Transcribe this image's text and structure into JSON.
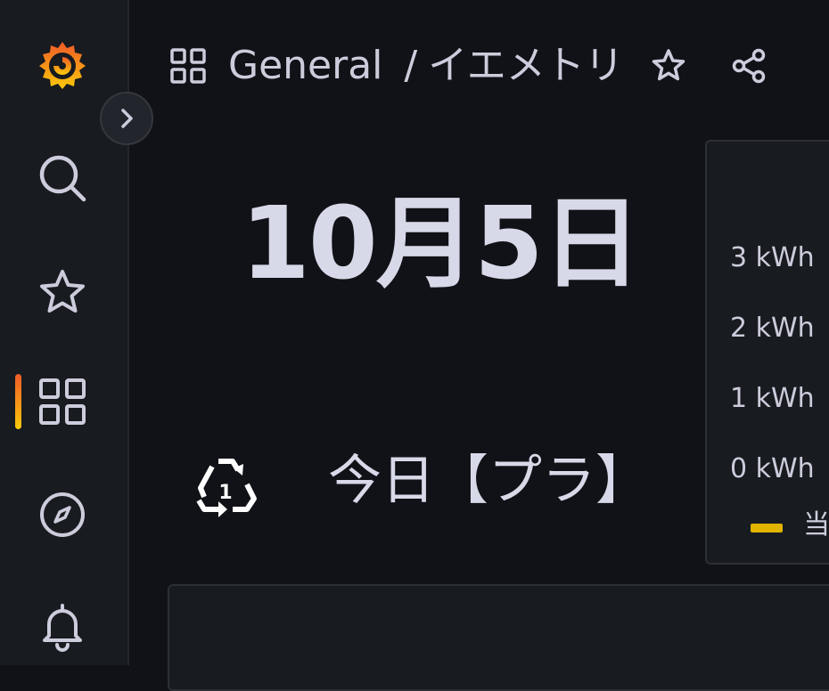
{
  "nav": {
    "items": [
      {
        "icon": "grafana-logo-icon"
      },
      {
        "icon": "search-icon"
      },
      {
        "icon": "star-icon"
      },
      {
        "icon": "dashboards-grid-icon",
        "active": true
      },
      {
        "icon": "explore-compass-icon"
      },
      {
        "icon": "alerting-bell-icon"
      }
    ],
    "expand_icon": "chevron-right-icon"
  },
  "breadcrumb": {
    "folder": "General",
    "separator": "/",
    "dashboard": "イエメトリ"
  },
  "header_actions": [
    "star-outline-icon",
    "share-icon"
  ],
  "panels": {
    "date": {
      "value": "10月5日"
    },
    "garbage": {
      "icon": "recycle-pet-1-icon",
      "label": "今日【プラ】"
    },
    "energy": {
      "y_ticks": [
        "3 kWh",
        "2 kWh",
        "1 kWh",
        "0 kWh"
      ],
      "legend_label": "当",
      "legend_color": "#e0b400"
    }
  },
  "colors": {
    "background": "#111217",
    "panel": "#181b1f",
    "accent": "#f05a28"
  }
}
